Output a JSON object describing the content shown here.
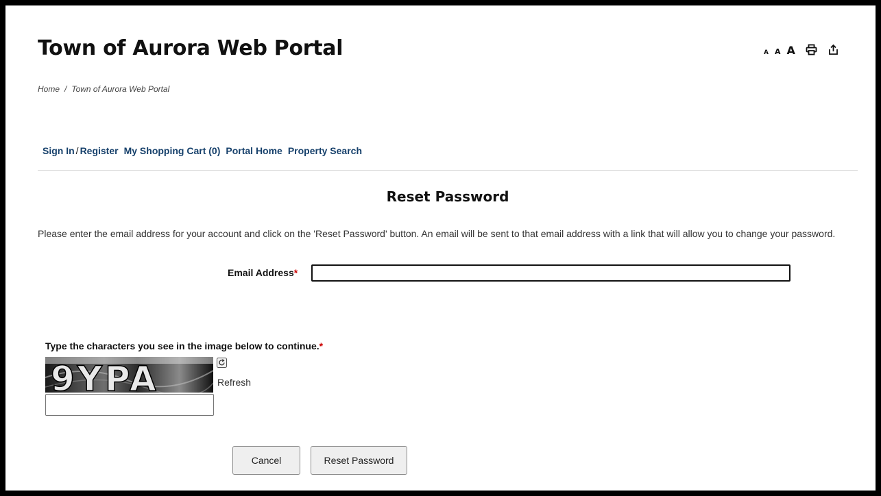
{
  "header": {
    "title": "Town of Aurora Web Portal",
    "font_small": "A",
    "font_medium": "A",
    "font_large": "A",
    "print_icon": "printer-icon",
    "share_icon": "share-icon"
  },
  "breadcrumb": {
    "home": "Home",
    "separator": "/",
    "current": "Town of Aurora Web Portal"
  },
  "nav": {
    "sign_in": "Sign In",
    "slash": "/",
    "register": "Register",
    "cart": "My Shopping Cart (0)",
    "portal_home": "Portal Home",
    "property_search": "Property Search"
  },
  "main": {
    "title": "Reset Password",
    "instructions": "Please enter the email address for your account and click on the 'Reset Password' button. An email will be sent to that email address with a link that will allow you to change your password.",
    "email_label": "Email Address",
    "required_marker": "*",
    "email_value": "",
    "captcha_label": "Type the characters you see in the image below to continue.",
    "captcha_text": "9YPA",
    "captcha_value": "",
    "refresh_label": "Refresh",
    "refresh_icon": "refresh-icon"
  },
  "buttons": {
    "cancel": "Cancel",
    "reset": "Reset Password"
  },
  "colors": {
    "nav_link": "#16406b",
    "required": "#cc0000",
    "title": "#111111"
  }
}
